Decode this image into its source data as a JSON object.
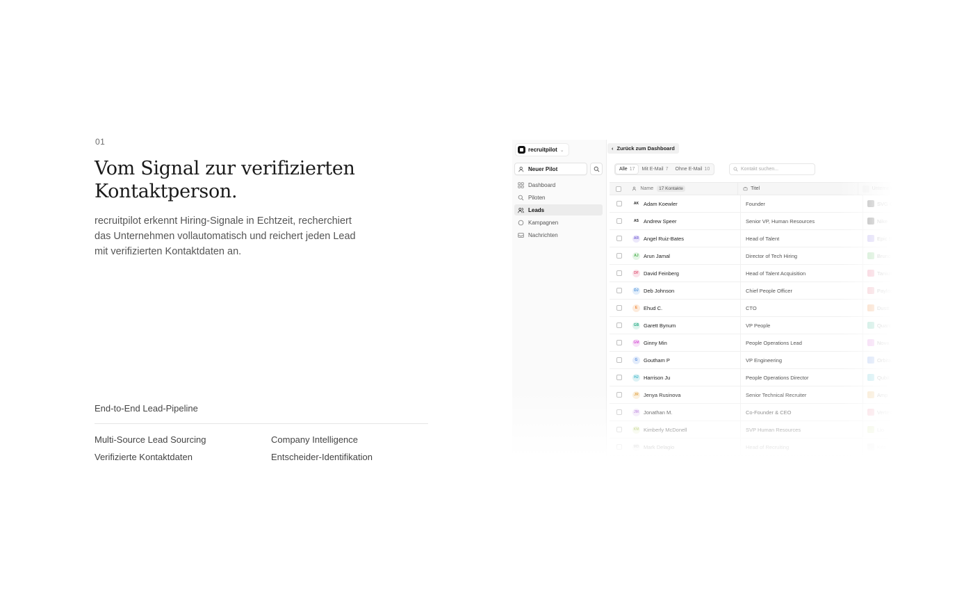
{
  "section": {
    "number": "01",
    "headline": "Vom Signal zur verifizierten Kontaktperson.",
    "lead": "recruitpilot erkennt Hiring-Signale in Echtzeit, recherchiert das Unternehmen vollautomatisch und reichert jeden Lead mit verifizierten Kontaktdaten an.",
    "pipeline_title": "End-to-End Lead-Pipeline",
    "features": [
      "Multi-Source Lead Sourcing",
      "Company Intelligence",
      "Verifizierte Kontaktdaten",
      "Entscheider-Identifikation"
    ]
  },
  "app": {
    "brand": "recruitpilot",
    "new_pilot": "Neuer Pilot",
    "nav": [
      {
        "label": "Dashboard",
        "icon": "grid-icon",
        "active": false
      },
      {
        "label": "Piloten",
        "icon": "search-icon",
        "active": false
      },
      {
        "label": "Leads",
        "icon": "users-icon",
        "active": true
      },
      {
        "label": "Kampagnen",
        "icon": "circle-icon",
        "active": false
      },
      {
        "label": "Nachrichten",
        "icon": "inbox-icon",
        "active": false
      }
    ],
    "back_label": "Zurück zum Dashboard",
    "filters": [
      {
        "label": "Alle",
        "count": "17",
        "active": true
      },
      {
        "label": "Mit E-Mail",
        "count": "7",
        "active": false
      },
      {
        "label": "Ohne E-Mail",
        "count": "10",
        "active": false
      }
    ],
    "search_placeholder": "Kontakt suchen...",
    "columns": {
      "name": "Name",
      "count": "17 Kontakte",
      "title": "Titel",
      "company": "Unternehmen"
    },
    "rows": [
      {
        "initials": "AK",
        "name": "Adam Koewler",
        "title": "Founder",
        "company": "SVG Co",
        "color": "#222222",
        "bg": "#ffffff",
        "logo": "#9a9a9a"
      },
      {
        "initials": "AS",
        "name": "Andrew Speer",
        "title": "Senior VP, Human Resources",
        "company": "Nike",
        "color": "#222222",
        "bg": "#ffffff",
        "logo": "#8f8f8f"
      },
      {
        "initials": "AR",
        "name": "Angel Ruiz-Bates",
        "title": "Head of Talent",
        "company": "Epic Sys",
        "color": "#7c6bd6",
        "bg": "#ece8fb",
        "logo": "#c9c2f2"
      },
      {
        "initials": "AJ",
        "name": "Arun Jamal",
        "title": "Director of Tech Hiring",
        "company": "Bruno",
        "color": "#4caf50",
        "bg": "#e4f5e5",
        "logo": "#b5e0b7"
      },
      {
        "initials": "DF",
        "name": "David Feinberg",
        "title": "Head of Talent Acquisition",
        "company": "Tanium",
        "color": "#e05a7a",
        "bg": "#fbe3ea",
        "logo": "#f2b4c4"
      },
      {
        "initials": "DJ",
        "name": "Deb Johnson",
        "title": "Chief People Officer",
        "company": "Paylocity",
        "color": "#4a8fd8",
        "bg": "#e2eefb",
        "logo": "#f2c0c8"
      },
      {
        "initials": "E",
        "name": "Ehud C.",
        "title": "CTO",
        "company": "Dustt",
        "color": "#f08a3c",
        "bg": "#fdebdc",
        "logo": "#f6c7a2"
      },
      {
        "initials": "GB",
        "name": "Garett Bynum",
        "title": "VP People",
        "company": "Quantu",
        "color": "#2fae8a",
        "bg": "#dff4ee",
        "logo": "#a8dfcf"
      },
      {
        "initials": "GM",
        "name": "Ginny Min",
        "title": "People Operations Lead",
        "company": "Nova",
        "color": "#d85bd8",
        "bg": "#f8e2f8",
        "logo": "#eec0ee"
      },
      {
        "initials": "G",
        "name": "Goutham P",
        "title": "VP Engineering",
        "company": "Orbital",
        "color": "#5b8fe0",
        "bg": "#e3ecfb",
        "logo": "#bcd0f3"
      },
      {
        "initials": "HJ",
        "name": "Harrison Ju",
        "title": "People Operations Director",
        "company": "Qubit",
        "color": "#3ab6c8",
        "bg": "#ddf2f5",
        "logo": "#b0e2ea"
      },
      {
        "initials": "JR",
        "name": "Jenya Rusinova",
        "title": "Senior Technical Recruiter",
        "company": "Amp",
        "color": "#e0a040",
        "bg": "#fbefdc",
        "logo": "#f3d8ad"
      },
      {
        "initials": "JM",
        "name": "Jonathan M.",
        "title": "Co-Founder & CEO",
        "company": "Vertex",
        "color": "#b070d8",
        "bg": "#f1e5f9",
        "logo": "#f3b9c6"
      },
      {
        "initials": "KM",
        "name": "Kimberly McDonell",
        "title": "SVP Human Resources",
        "company": "Lio",
        "color": "#9bb83a",
        "bg": "#eef4da",
        "logo": "#d5e4a6"
      },
      {
        "initials": "MD",
        "name": "Mark Delagio",
        "title": "Head of Recruiting",
        "company": "Kite",
        "color": "#888888",
        "bg": "#eeeeee",
        "logo": "#cfcfcf"
      }
    ]
  }
}
